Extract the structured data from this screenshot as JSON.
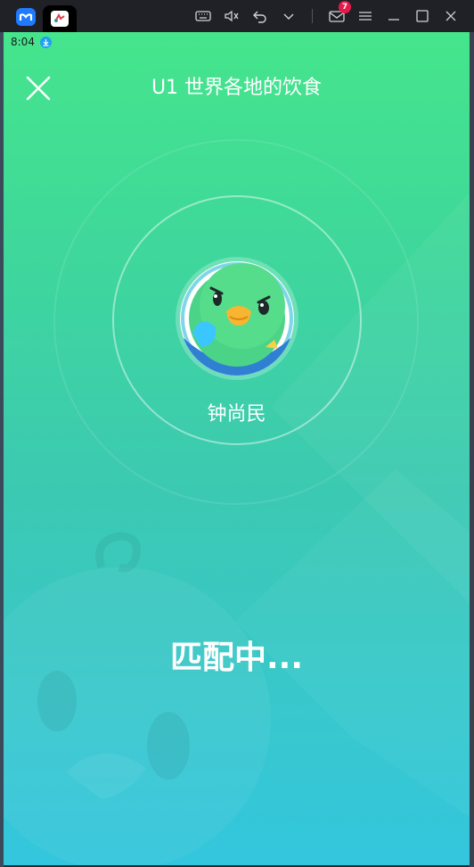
{
  "emulator": {
    "message_badge_count": "7"
  },
  "status_bar": {
    "time": "8:04"
  },
  "header": {
    "title": "U1 世界各地的饮食"
  },
  "player": {
    "name": "钟尚民"
  },
  "status": {
    "matching_text": "匹配中..."
  },
  "colors": {
    "gradient_top": "#45e58c",
    "gradient_bottom": "#33c6dd",
    "text": "#ffffff"
  }
}
